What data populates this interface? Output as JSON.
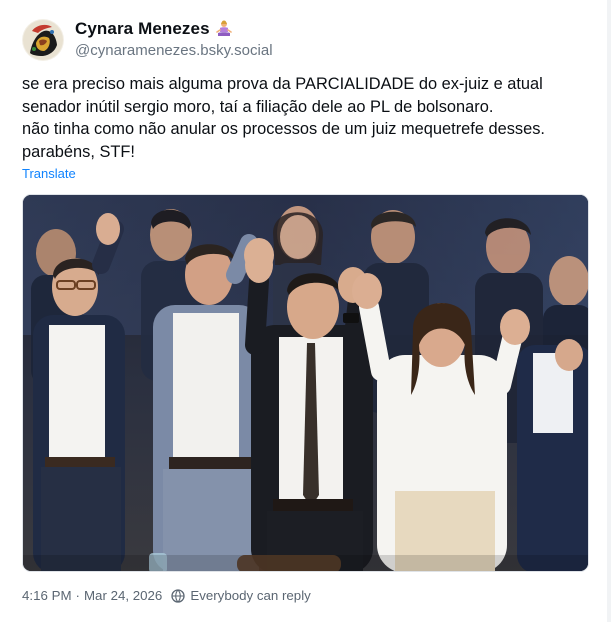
{
  "author": {
    "display_name": "Cynara Menezes",
    "handle": "@cynaramenezes.bsky.social",
    "avatar_icon": "avatar-illustration",
    "name_emoji_icon": "person-emoji-icon"
  },
  "post": {
    "lines": [
      "se era preciso mais alguma prova da PARCIALIDADE do ex-juiz e atual",
      "senador inútil sergio moro, taí a filiação dele ao PL de bolsonaro.",
      "não tinha como não anular os processos de um juiz mequetrefe desses.",
      "parabéns, STF!"
    ],
    "translate_label": "Translate",
    "image_icon": "group-photo-image"
  },
  "meta": {
    "time": "4:16 PM",
    "separator": "·",
    "date": "Mar 24, 2026",
    "reply_icon": "globe-reply-icon",
    "reply_setting": "Everybody can reply"
  },
  "colors": {
    "link": "#1083fe",
    "text": "#0b0f14",
    "muted": "#5b6672"
  }
}
